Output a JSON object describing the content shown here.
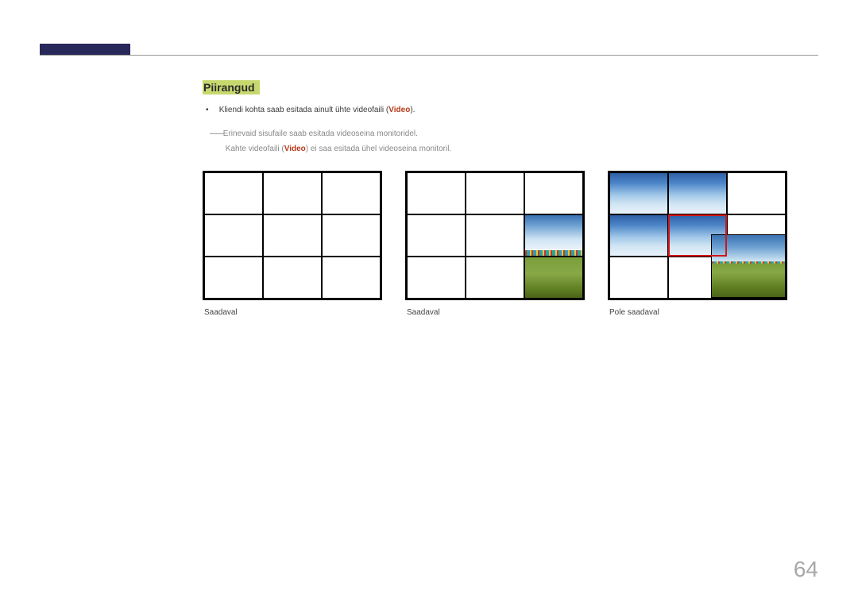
{
  "section_heading": "Piirangud",
  "bullets": {
    "b1_prefix": "Kliendi kohta saab esitada ainult ühte videofaili (",
    "b1_highlight": "Video",
    "b1_suffix": ")."
  },
  "subnote": {
    "line1": "Erinevaid sisufaile saab esitada videoseina monitoridel.",
    "line2_prefix": "Kahte videofaili (",
    "line2_highlight": "Video",
    "line2_suffix": ") ei saa esitada ühel videoseina monitoril."
  },
  "captions": {
    "grid1": "Saadaval",
    "grid2": "Saadaval",
    "grid3": "Pole saadaval"
  },
  "page_number": "64"
}
